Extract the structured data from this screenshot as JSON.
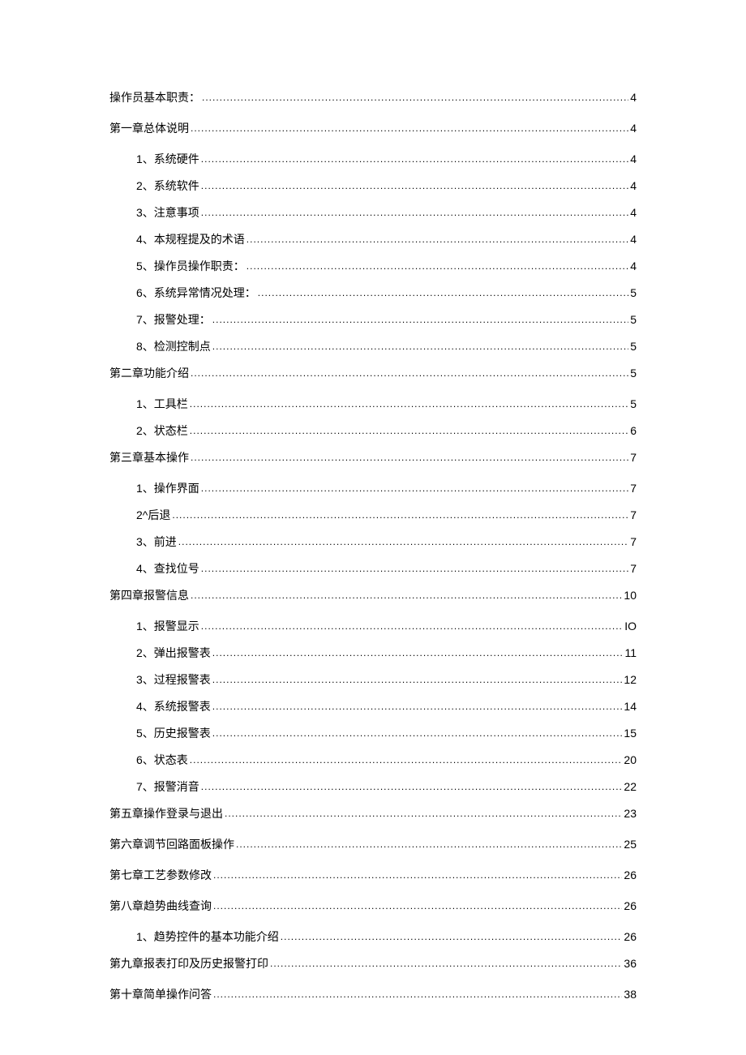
{
  "toc": [
    {
      "level": 1,
      "label": "操作员基本职责：",
      "page": "4",
      "spacing": "wide"
    },
    {
      "level": 1,
      "label": "第一章总体说明",
      "page": "4",
      "spacing": "wide"
    },
    {
      "level": 2,
      "label": "1、系统硬件",
      "page": "4"
    },
    {
      "level": 2,
      "label": "2、系统软件",
      "page": "4"
    },
    {
      "level": 2,
      "label": "3、注意事项",
      "page": "4"
    },
    {
      "level": 2,
      "label": "4、本规程提及的术语",
      "page": "4"
    },
    {
      "level": 2,
      "label": "5、操作员操作职责：",
      "page": "4"
    },
    {
      "level": 2,
      "label": "6、系统异常情况处理：",
      "page": "5"
    },
    {
      "level": 2,
      "label": "7、报警处理：",
      "page": "5"
    },
    {
      "level": 2,
      "label": "8、检测控制点",
      "page": "5"
    },
    {
      "level": 1,
      "label": "第二章功能介绍",
      "page": "5",
      "spacing": "wide"
    },
    {
      "level": 2,
      "label": "1、工具栏",
      "page": "5"
    },
    {
      "level": 2,
      "label": "2、状态栏",
      "page": "6"
    },
    {
      "level": 1,
      "label": "第三章基本操作",
      "page": "7",
      "spacing": "wide"
    },
    {
      "level": 2,
      "label": "1、操作界面",
      "page": "7"
    },
    {
      "level": 2,
      "label": "2^后退",
      "page": "7"
    },
    {
      "level": 2,
      "label": "3、前进",
      "page": "7"
    },
    {
      "level": 2,
      "label": "4、查找位号",
      "page": "7"
    },
    {
      "level": 1,
      "label": "第四章报警信息",
      "page": "10",
      "spacing": "wide"
    },
    {
      "level": 2,
      "label": "1、报警显示",
      "page": "IO"
    },
    {
      "level": 2,
      "label": "2、弹出报警表",
      "page": "11"
    },
    {
      "level": 2,
      "label": "3、过程报警表",
      "page": "12"
    },
    {
      "level": 2,
      "label": "4、系统报警表",
      "page": "14"
    },
    {
      "level": 2,
      "label": "5、历史报警表",
      "page": "15"
    },
    {
      "level": 2,
      "label": "6、状态表",
      "page": "20"
    },
    {
      "level": 2,
      "label": "7、报警消音",
      "page": "22"
    },
    {
      "level": 1,
      "label": "第五章操作登录与退出",
      "page": "23",
      "spacing": "wide"
    },
    {
      "level": 1,
      "label": "第六章调节回路面板操作",
      "page": "25",
      "spacing": "wide"
    },
    {
      "level": 1,
      "label": "第七章工艺参数修改",
      "page": "26",
      "spacing": "wide"
    },
    {
      "level": 1,
      "label": "第八章趋势曲线查询",
      "page": "26",
      "spacing": "wide"
    },
    {
      "level": 2,
      "label": "1、趋势控件的基本功能介绍",
      "page": "26"
    },
    {
      "level": 1,
      "label": "第九章报表打印及历史报警打印",
      "page": "36",
      "spacing": "wide"
    },
    {
      "level": 1,
      "label": "第十章简单操作问答",
      "page": "38",
      "spacing": "wide"
    }
  ]
}
